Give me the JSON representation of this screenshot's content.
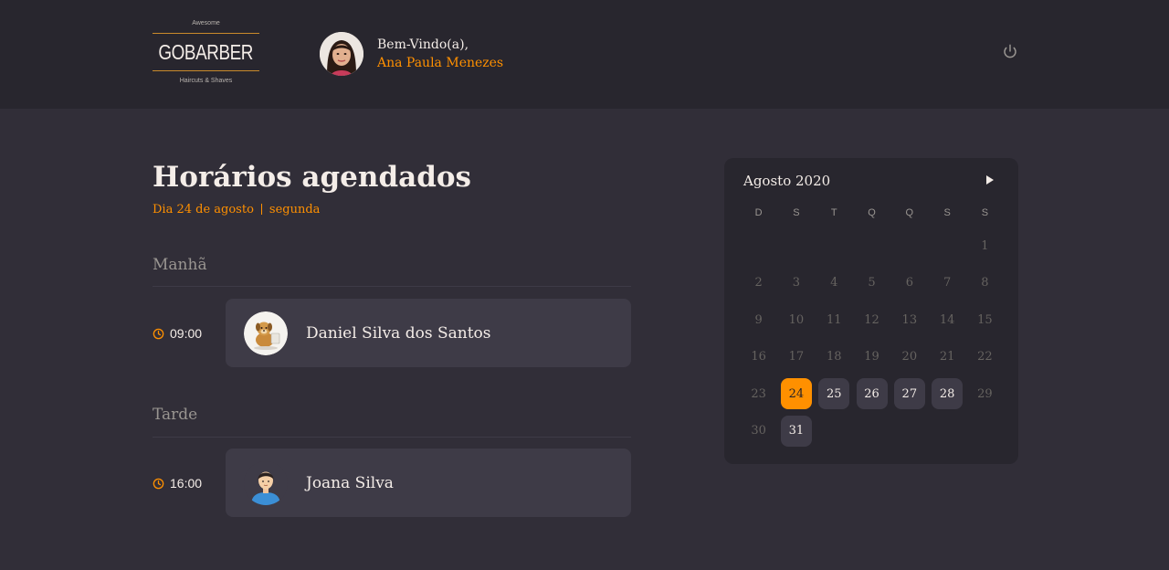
{
  "header": {
    "logo": {
      "top": "Awesome",
      "main": "GOBARBER",
      "bottom": "Haircuts & Shaves"
    },
    "welcome_label": "Bem-Vindo(a),",
    "user_name": "Ana Paula Menezes",
    "icons": {
      "avatar": "user-photo",
      "power": "power-icon"
    }
  },
  "schedule": {
    "title": "Horários agendados",
    "date_text": "Dia 24 de agosto",
    "weekday": "segunda",
    "sections": [
      {
        "title": "Manhã",
        "appointments": [
          {
            "time": "09:00",
            "name": "Daniel Silva dos Santos",
            "avatar_icon": "dog-avatar"
          }
        ]
      },
      {
        "title": "Tarde",
        "appointments": [
          {
            "time": "16:00",
            "name": "Joana Silva",
            "avatar_icon": "person-avatar"
          }
        ]
      }
    ]
  },
  "calendar": {
    "title": "Agosto 2020",
    "weekdays": [
      "D",
      "S",
      "T",
      "Q",
      "Q",
      "S",
      "S"
    ],
    "weeks": [
      [
        "",
        "",
        "",
        "",
        "",
        "",
        "1"
      ],
      [
        "2",
        "3",
        "4",
        "5",
        "6",
        "7",
        "8"
      ],
      [
        "9",
        "10",
        "11",
        "12",
        "13",
        "14",
        "15"
      ],
      [
        "16",
        "17",
        "18",
        "19",
        "20",
        "21",
        "22"
      ],
      [
        "23",
        "24",
        "25",
        "26",
        "27",
        "28",
        "29"
      ],
      [
        "30",
        "31",
        "",
        "",
        "",
        "",
        ""
      ]
    ],
    "selected_day": "24",
    "available_days": [
      "25",
      "26",
      "27",
      "28",
      "31"
    ]
  },
  "colors": {
    "accent": "#ff9000",
    "background": "#312e38",
    "header": "#28262e",
    "card": "#3e3b47"
  }
}
